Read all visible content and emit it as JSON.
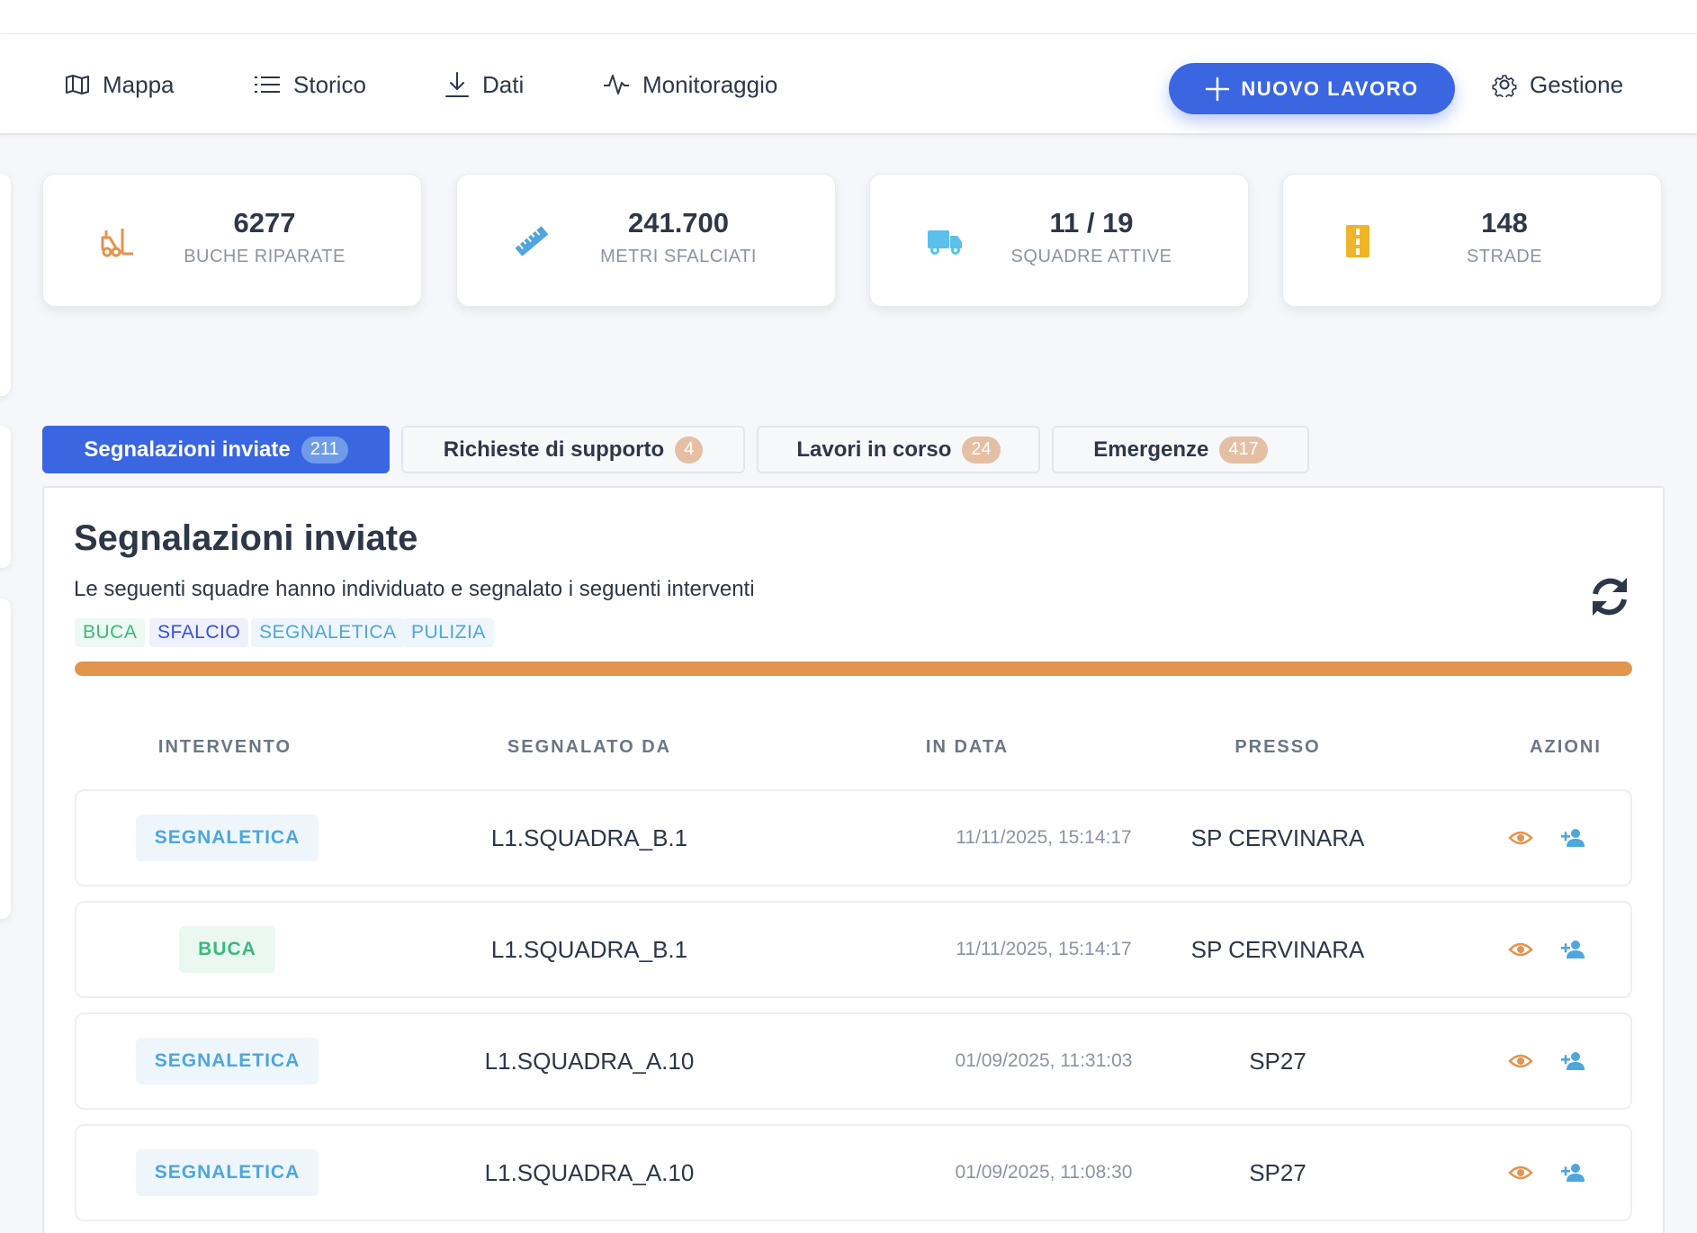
{
  "nav": {
    "items": [
      {
        "label": "Mappa",
        "icon": "map-icon"
      },
      {
        "label": "Storico",
        "icon": "list-icon"
      },
      {
        "label": "Dati",
        "icon": "download-icon"
      },
      {
        "label": "Monitoraggio",
        "icon": "activity-icon"
      }
    ],
    "new_button": "NUOVO LAVORO",
    "settings": "Gestione"
  },
  "stats": [
    {
      "value": "6277",
      "label": "BUCHE RIPARATE",
      "icon": "forklift-icon",
      "color": "#e3944d"
    },
    {
      "value": "241.700",
      "label": "METRI SFALCIATI",
      "icon": "ruler-icon",
      "color": "#4ea6dd"
    },
    {
      "value": "11 / 19",
      "label": "SQUADRE ATTIVE",
      "icon": "truck-icon",
      "color": "#5bc0eb"
    },
    {
      "value": "148",
      "label": "STRADE",
      "icon": "road-icon",
      "color": "#f0b429"
    }
  ],
  "tabs": [
    {
      "label": "Segnalazioni inviate",
      "count": "211"
    },
    {
      "label": "Richieste di supporto",
      "count": "4"
    },
    {
      "label": "Lavori in corso",
      "count": "24"
    },
    {
      "label": "Emergenze",
      "count": "417"
    }
  ],
  "panel": {
    "title": "Segnalazioni inviate",
    "subtitle": "Le seguenti squadre hanno individuato e segnalato i seguenti interventi",
    "chips": [
      "BUCA",
      "SFALCIO",
      "SEGNALETICA",
      "PULIZIA"
    ],
    "progress": 1.0
  },
  "table": {
    "headers": [
      "INTERVENTO",
      "SEGNALATO DA",
      "IN DATA",
      "PRESSO",
      "AZIONI"
    ],
    "rows": [
      {
        "type": "SEGNALETICA",
        "by": "L1.SQUADRA_B.1",
        "date": "11/11/2025, 15:14:17",
        "place": "SP CERVINARA"
      },
      {
        "type": "BUCA",
        "by": "L1.SQUADRA_B.1",
        "date": "11/11/2025, 15:14:17",
        "place": "SP CERVINARA"
      },
      {
        "type": "SEGNALETICA",
        "by": "L1.SQUADRA_A.10",
        "date": "01/09/2025, 11:31:03",
        "place": "SP27"
      },
      {
        "type": "SEGNALETICA",
        "by": "L1.SQUADRA_A.10",
        "date": "01/09/2025, 11:08:30",
        "place": "SP27"
      }
    ]
  },
  "colors": {
    "accent": "#3a66e2",
    "progress": "#e3944d",
    "chip_buca": "#3bb97c",
    "chip_sfalcio": "#3a4fd6",
    "chip_segnaletica": "#4ea6dd",
    "chip_pulizia": "#4ea6dd"
  }
}
